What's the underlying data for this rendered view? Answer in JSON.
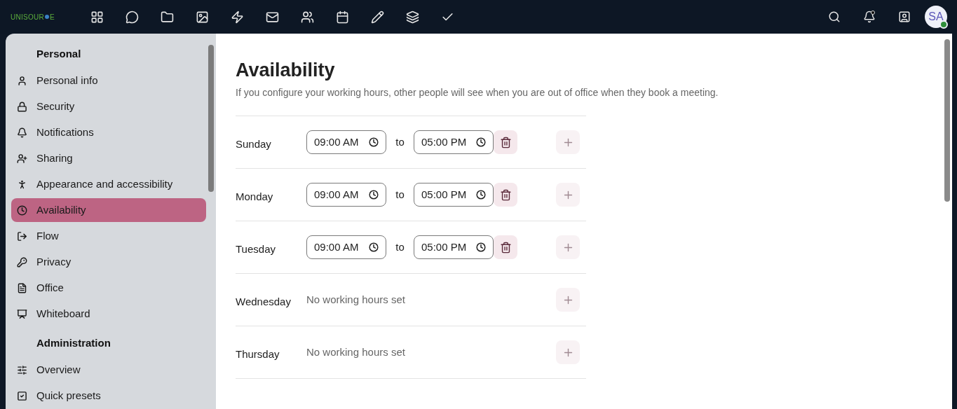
{
  "topbar": {
    "logo": {
      "text_start": "UNISOUR",
      "text_end": "E"
    },
    "apps": [
      {
        "kind": "dashboard"
      },
      {
        "kind": "talk"
      },
      {
        "kind": "files"
      },
      {
        "kind": "photos"
      },
      {
        "kind": "activity"
      },
      {
        "kind": "mail"
      },
      {
        "kind": "contacts"
      },
      {
        "kind": "calendar"
      },
      {
        "kind": "notes"
      },
      {
        "kind": "deck"
      },
      {
        "kind": "tasks"
      }
    ],
    "actions": [
      {
        "kind": "search"
      },
      {
        "kind": "notifications",
        "unread": true
      },
      {
        "kind": "contacts"
      }
    ],
    "avatar": {
      "initials": "SA",
      "online": true
    }
  },
  "sidebar": {
    "sections": [
      {
        "title": "Personal",
        "items": [
          {
            "kind": "user",
            "label": "Personal info",
            "selected": false
          },
          {
            "kind": "lock",
            "label": "Security",
            "selected": false
          },
          {
            "kind": "bell",
            "label": "Notifications",
            "selected": false
          },
          {
            "kind": "share",
            "label": "Sharing",
            "selected": false
          },
          {
            "kind": "accessibility",
            "label": "Appearance and accessibility",
            "selected": false
          },
          {
            "kind": "clock",
            "label": "Availability",
            "selected": true
          },
          {
            "kind": "flow",
            "label": "Flow",
            "selected": false
          },
          {
            "kind": "key",
            "label": "Privacy",
            "selected": false
          },
          {
            "kind": "file",
            "label": "Office",
            "selected": false
          },
          {
            "kind": "whiteboard",
            "label": "Whiteboard",
            "selected": false
          }
        ]
      },
      {
        "title": "Administration",
        "items": [
          {
            "kind": "sliders",
            "label": "Overview",
            "selected": false
          },
          {
            "kind": "check",
            "label": "Quick presets",
            "selected": false
          }
        ]
      }
    ]
  },
  "main": {
    "title": "Availability",
    "description": "If you configure your working hours, other people will see when you are out of office when they book a meeting.",
    "days": [
      {
        "day": "Sunday",
        "kind": "hours",
        "from": "09:00 AM",
        "separator": "to",
        "to": "05:00 PM"
      },
      {
        "day": "Monday",
        "kind": "hours",
        "from": "09:00 AM",
        "separator": "to",
        "to": "05:00 PM"
      },
      {
        "day": "Tuesday",
        "kind": "hours",
        "from": "09:00 AM",
        "separator": "to",
        "to": "05:00 PM"
      },
      {
        "day": "Wednesday",
        "kind": "empty",
        "message": "No working hours set"
      },
      {
        "day": "Thursday",
        "kind": "empty",
        "message": "No working hours set"
      }
    ]
  }
}
